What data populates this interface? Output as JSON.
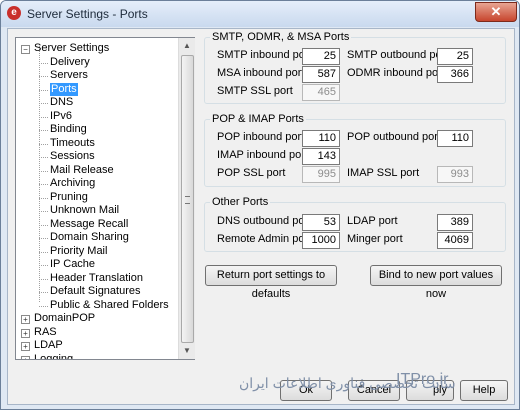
{
  "window": {
    "title": "Server Settings - Ports",
    "close_glyph": "✕",
    "icon_glyph": "e"
  },
  "tree": {
    "items": [
      {
        "label": "Server Settings",
        "expanded": true
      },
      {
        "label": "Delivery"
      },
      {
        "label": "Servers"
      },
      {
        "label": "Ports",
        "selected": true
      },
      {
        "label": "DNS"
      },
      {
        "label": "IPv6"
      },
      {
        "label": "Binding"
      },
      {
        "label": "Timeouts"
      },
      {
        "label": "Sessions"
      },
      {
        "label": "Mail Release"
      },
      {
        "label": "Archiving"
      },
      {
        "label": "Pruning"
      },
      {
        "label": "Unknown Mail"
      },
      {
        "label": "Message Recall"
      },
      {
        "label": "Domain Sharing"
      },
      {
        "label": "Priority Mail"
      },
      {
        "label": "IP Cache"
      },
      {
        "label": "Header Translation"
      },
      {
        "label": "Default Signatures"
      },
      {
        "label": "Public & Shared Folders"
      },
      {
        "label": "DomainPOP",
        "expanded": false
      },
      {
        "label": "RAS",
        "expanded": false
      },
      {
        "label": "LDAP",
        "expanded": false
      },
      {
        "label": "Logging",
        "expanded": false
      }
    ],
    "expand_plus": "+",
    "expand_minus": "−"
  },
  "smtp_group": {
    "title": "SMTP, ODMR, & MSA Ports",
    "smtp_in_label": "SMTP inbound port",
    "smtp_in_value": "25",
    "smtp_out_label": "SMTP outbound port",
    "smtp_out_value": "25",
    "msa_in_label": "MSA inbound port",
    "msa_in_value": "587",
    "odmr_in_label": "ODMR inbound port",
    "odmr_in_value": "366",
    "smtp_ssl_label": "SMTP SSL port",
    "smtp_ssl_value": "465"
  },
  "pop_group": {
    "title": "POP & IMAP Ports",
    "pop_in_label": "POP inbound port",
    "pop_in_value": "110",
    "pop_out_label": "POP outbound port",
    "pop_out_value": "110",
    "imap_in_label": "IMAP inbound port",
    "imap_in_value": "143",
    "pop_ssl_label": "POP SSL port",
    "pop_ssl_value": "995",
    "imap_ssl_label": "IMAP SSL port",
    "imap_ssl_value": "993"
  },
  "other_group": {
    "title": "Other Ports",
    "dns_out_label": "DNS outbound port",
    "dns_out_value": "53",
    "ldap_label": "LDAP port",
    "ldap_value": "389",
    "remote_admin_label": "Remote Admin port",
    "remote_admin_value": "1000",
    "minger_label": "Minger port",
    "minger_value": "4069"
  },
  "buttons": {
    "return_defaults": "Return port settings to defaults",
    "bind_new": "Bind to new port values now",
    "ok": "Ok",
    "cancel": "Cancel",
    "apply": "ply",
    "help": "Help"
  },
  "watermark": {
    "text": "سایت تخصصی فناوری اطلاعات ایران",
    "brand": "ITPro.ir"
  },
  "colors": {
    "selection": "#3399ff",
    "title_bar": "#c9d9ee",
    "close_button": "#c7452d"
  }
}
